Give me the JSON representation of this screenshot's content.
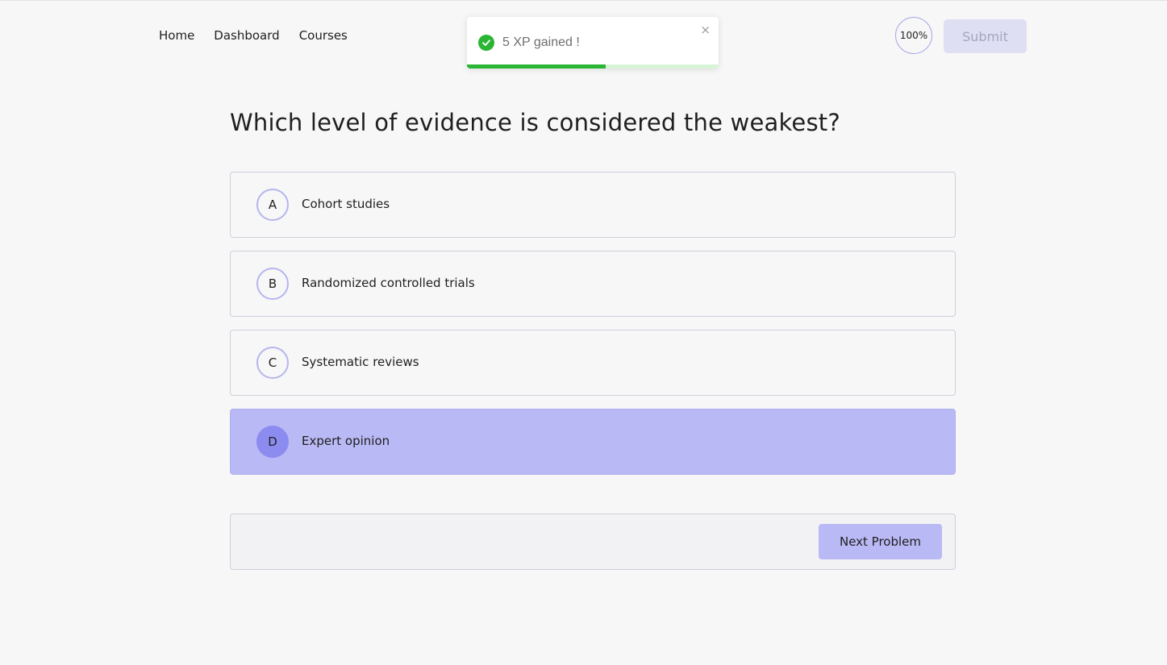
{
  "nav": {
    "items": [
      {
        "label": "Home"
      },
      {
        "label": "Dashboard"
      },
      {
        "label": "Courses"
      }
    ]
  },
  "header": {
    "progress_label": "100%",
    "submit_label": "Submit"
  },
  "toast": {
    "message": "5 XP gained !",
    "close_glyph": "×",
    "icon": "check-circle-icon",
    "progress_fraction": 0.55,
    "accent_color": "#2bb534"
  },
  "question": {
    "text": "Which level of evidence is considered the weakest?",
    "options": [
      {
        "letter": "A",
        "text": "Cohort studies",
        "selected": false
      },
      {
        "letter": "B",
        "text": "Randomized controlled trials",
        "selected": false
      },
      {
        "letter": "C",
        "text": "Systematic reviews",
        "selected": false
      },
      {
        "letter": "D",
        "text": "Expert opinion",
        "selected": true
      }
    ]
  },
  "footer": {
    "next_label": "Next Problem"
  },
  "colors": {
    "accent": "#b9b9f5",
    "accent_dark": "#8c8cf0",
    "success": "#2bb534"
  }
}
